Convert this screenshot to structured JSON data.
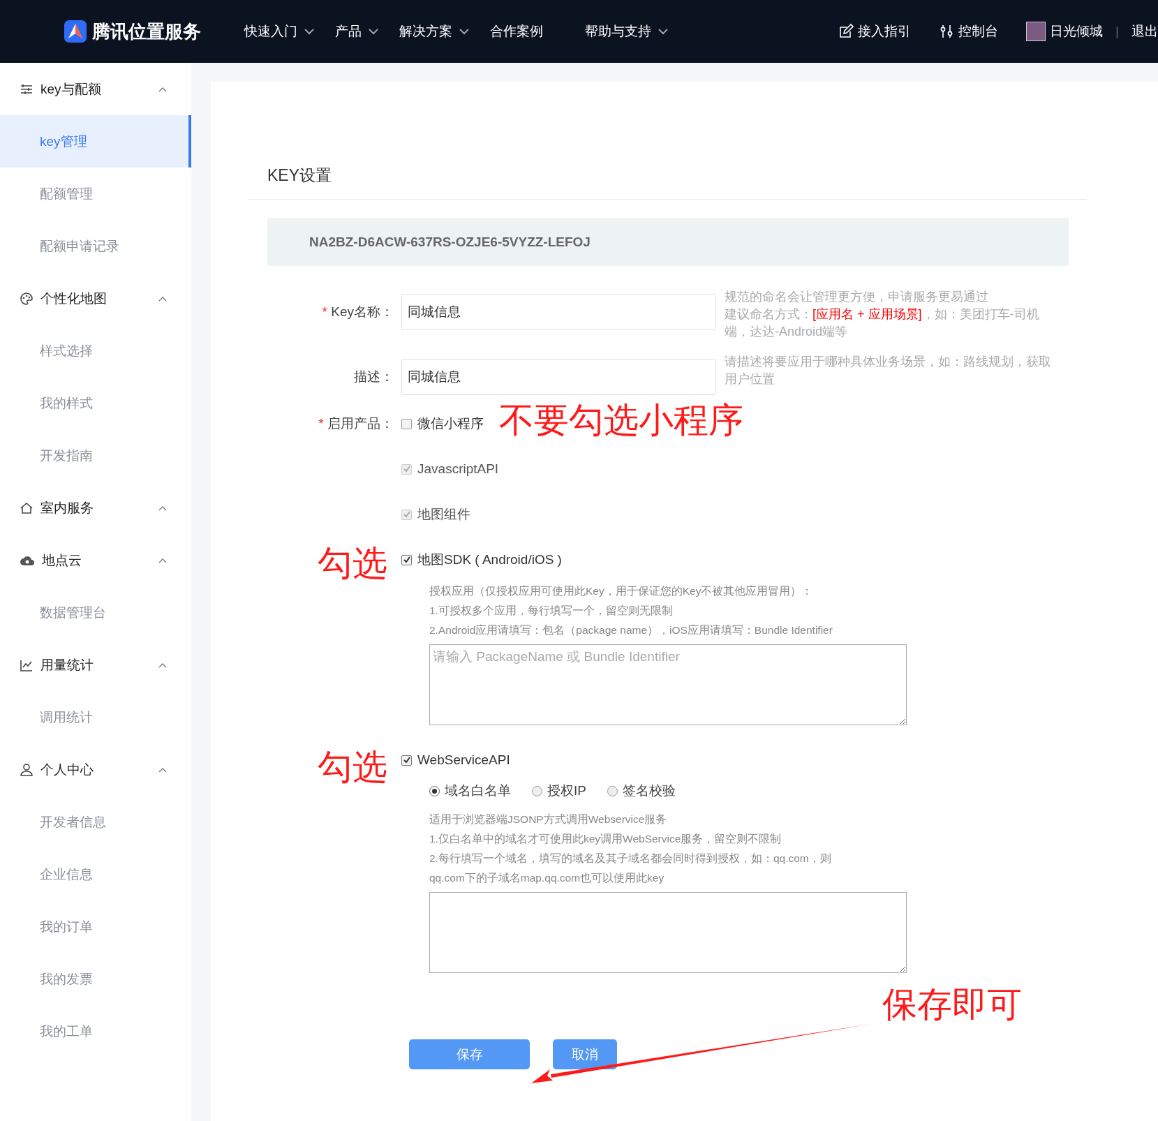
{
  "header": {
    "logo_text": "腾讯位置服务",
    "nav": [
      {
        "label": "快速入门",
        "dropdown": true
      },
      {
        "label": "产品",
        "dropdown": true
      },
      {
        "label": "解决方案",
        "dropdown": true
      },
      {
        "label": "合作案例",
        "dropdown": false
      },
      {
        "label": "帮助与支持",
        "dropdown": true
      }
    ],
    "links": [
      {
        "label": "接入指引",
        "kind": "guide"
      },
      {
        "label": "控制台",
        "kind": "console"
      }
    ],
    "user": "日光倾城",
    "separator": "|",
    "logout": "退出"
  },
  "sidebar": [
    {
      "label": "key与配额",
      "kind": "list",
      "expanded": true,
      "items": [
        {
          "label": "key管理",
          "selected": true
        },
        {
          "label": "配额管理",
          "selected": false
        },
        {
          "label": "配额申请记录",
          "selected": false
        }
      ]
    },
    {
      "label": "个性化地图",
      "kind": "palette",
      "expanded": true,
      "items": [
        {
          "label": "样式选择",
          "selected": false
        },
        {
          "label": "我的样式",
          "selected": false
        },
        {
          "label": "开发指南",
          "selected": false
        }
      ]
    },
    {
      "label": "室内服务",
      "kind": "home",
      "expanded": true
    },
    {
      "label": "地点云",
      "kind": "cloud",
      "expanded": true,
      "items": [
        {
          "label": "数据管理台",
          "selected": false
        }
      ]
    },
    {
      "label": "用量统计",
      "kind": "chart",
      "expanded": true,
      "items": [
        {
          "label": "调用统计",
          "selected": false
        }
      ]
    },
    {
      "label": "个人中心",
      "kind": "person",
      "expanded": true,
      "items": [
        {
          "label": "开发者信息",
          "selected": false
        },
        {
          "label": "企业信息",
          "selected": false
        },
        {
          "label": "我的订单",
          "selected": false
        },
        {
          "label": "我的发票",
          "selected": false
        },
        {
          "label": "我的工单",
          "selected": false
        }
      ]
    }
  ],
  "form": {
    "title": "KEY设置",
    "required_mark": "*",
    "key_value": "NA2BZ-D6ACW-637RS-OZJE6-5VYZZ-LEFOJ",
    "fields": [
      {
        "label": "Key名称：",
        "required": true,
        "value": "同城信息",
        "hint": [
          [
            {
              "text": "规范的命名会让管理更方便，申请服务更易通过",
              "highlight": false
            }
          ],
          [
            {
              "text": "建议命名方式：",
              "highlight": false
            },
            {
              "text": "[应用名 + 应用场景]",
              "highlight": true
            },
            {
              "text": "，如：美团打车-司机端，达达-Android端等",
              "highlight": false
            }
          ]
        ]
      },
      {
        "label": "描述：",
        "required": false,
        "value": "同城信息",
        "hint": [
          [
            {
              "text": "请描述将要应用于哪种具体业务场景，如：路线规划，获取用户位置",
              "highlight": false
            }
          ]
        ]
      }
    ],
    "products_label": "启用产品：",
    "products_required": true,
    "products": [
      {
        "label": "微信小程序",
        "checked": false,
        "disabled": false,
        "kind": "plain",
        "annotation": "不要勾选小程序"
      },
      {
        "label": "JavascriptAPI",
        "checked": true,
        "disabled": true,
        "kind": "plain"
      },
      {
        "label": "地图组件",
        "checked": true,
        "disabled": true,
        "kind": "plain"
      },
      {
        "label": "地图SDK ( Android/iOS )",
        "checked": true,
        "disabled": false,
        "kind": "sdk",
        "annotation": "勾选",
        "help": [
          "授权应用（仅授权应用可使用此Key，用于保证您的Key不被其他应用冒用）：",
          "1.可授权多个应用，每行填写一个，留空则无限制",
          "2.Android应用请填写：包名（package name），iOS应用请填写：Bundle Identifier"
        ],
        "placeholder": "请输入 PackageName 或 Bundle Identifier"
      },
      {
        "label": "WebServiceAPI",
        "checked": true,
        "disabled": false,
        "kind": "webservice",
        "annotation": "勾选",
        "options": [
          {
            "label": "域名白名单",
            "selected": true
          },
          {
            "label": "授权IP",
            "selected": false
          },
          {
            "label": "签名校验",
            "selected": false
          }
        ],
        "help": [
          "适用于浏览器端JSONP方式调用Webservice服务",
          "1.仅白名单中的域名才可使用此key调用WebService服务，留空则不限制",
          "2.每行填写一个域名，填写的域名及其子域名都会同时得到授权，如：qq.com，则qq.com下的子域名map.qq.com也可以使用此key"
        ]
      }
    ],
    "buttons": [
      {
        "label": "保存",
        "kind": "primary"
      },
      {
        "label": "取消",
        "kind": "secondary"
      }
    ],
    "callout": "保存即可"
  }
}
